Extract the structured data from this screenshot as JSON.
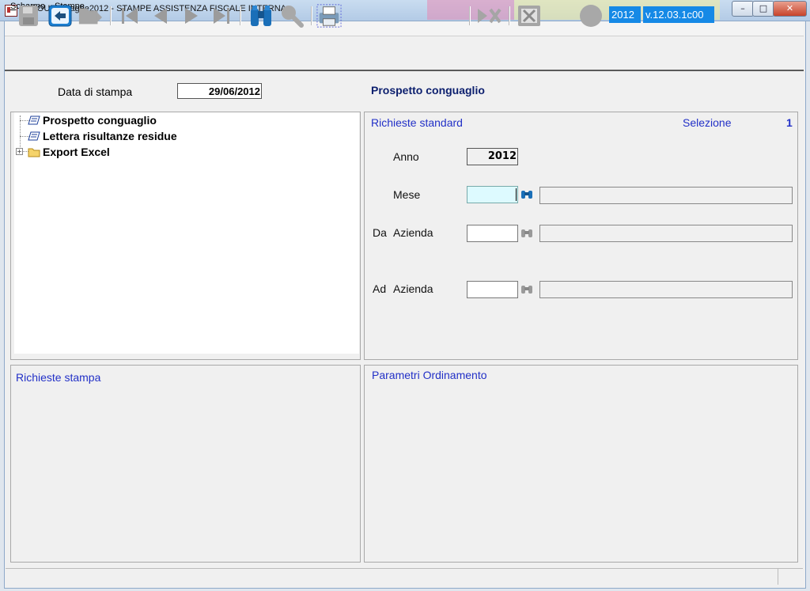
{
  "window": {
    "title": "LABOUR - Paghe2012 - STAMPE ASSISTENZA FISCALE INTERNA",
    "buttons": {
      "minimize": "–",
      "maximize": "□",
      "close": "✕"
    }
  },
  "menubar": {
    "items": [
      {
        "label": "Schermo",
        "accel": "S",
        "rest": "chermo"
      },
      {
        "label": "Stampe",
        "accel": "S",
        "rest": "tampe"
      }
    ]
  },
  "toolbar": {
    "icons": [
      "save-icon",
      "back-icon",
      "open-folder-icon",
      "first-record-icon",
      "previous-record-icon",
      "next-record-icon",
      "last-record-icon",
      "binoculars-icon",
      "magnifier-icon",
      "print-preview-icon",
      "skip-icon",
      "excel-export-icon",
      "status-circle-icon"
    ],
    "year_badge": "2012",
    "version_badge": "v.12.03.1c00",
    "accent_color": "#1589e6"
  },
  "header": {
    "data_label": "Data di stampa",
    "data_value": "29/06/2012",
    "page_title": "Prospetto conguaglio"
  },
  "tree": {
    "items": [
      {
        "label": "Prospetto conguaglio",
        "icon": "report-icon"
      },
      {
        "label": "Lettera risultanze residue",
        "icon": "report-icon"
      },
      {
        "label": "Export Excel",
        "icon": "folder-icon",
        "expandable": true
      }
    ]
  },
  "standard": {
    "heading": "Richieste standard",
    "selection_label": "Selezione",
    "selection_value": "1",
    "anno_label": "Anno",
    "anno_value": "2012",
    "mese_label": "Mese",
    "mese_value": "",
    "da_prefix": "Da",
    "da_label": "Azienda",
    "da_value": "",
    "ad_prefix": "Ad",
    "ad_label": "Azienda",
    "ad_value": ""
  },
  "richieste_stampa": {
    "heading": "Richieste stampa"
  },
  "parametri": {
    "heading": "Parametri Ordinamento"
  },
  "colors": {
    "heading_blue": "#2230c7",
    "title_navy": "#0c1f6e",
    "active_field": "#ddfaff"
  }
}
